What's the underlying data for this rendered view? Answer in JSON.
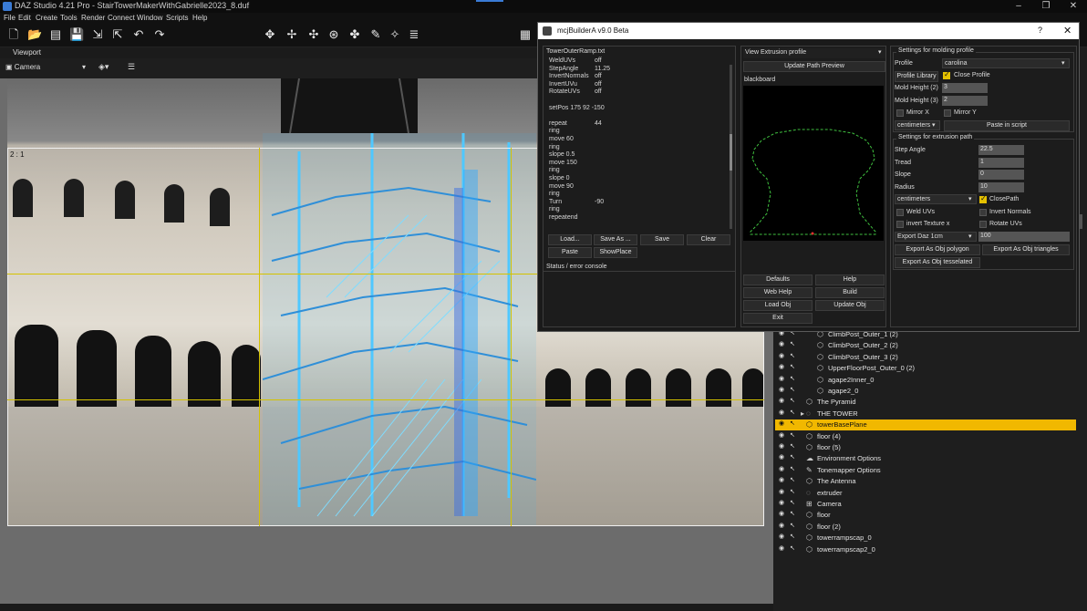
{
  "app": {
    "title": "DAZ Studio 4.21 Pro - StairTowerMakerWithGabrielle2023_8.duf",
    "icon": "daz-studio-icon",
    "window_controls": [
      "–",
      "❐",
      "✕"
    ]
  },
  "menu": [
    "File",
    "Edit",
    "Create",
    "Tools",
    "Render",
    "Connect",
    "Window",
    "Scripts",
    "Help"
  ],
  "viewport": {
    "tab_label": "Viewport",
    "camera": "Camera",
    "frame_label": "2 : 1"
  },
  "plugin": {
    "title": "mcjBuilderA v9.0 Beta",
    "help": "?",
    "close": "✕",
    "script": {
      "file_name": "TowerOuterRamp.txt",
      "lines": [
        {
          "k": "WeldUVs",
          "v": "off"
        },
        {
          "k": "StepAngle",
          "v": "11.25"
        },
        {
          "k": "InvertNormals",
          "v": "off"
        },
        {
          "k": "InvertUVu",
          "v": "off"
        },
        {
          "k": "RotateUVs",
          "v": "off"
        },
        {
          "k": "",
          "v": ""
        },
        {
          "k": "setPos 175 92 -150",
          "v": ""
        },
        {
          "k": "",
          "v": ""
        },
        {
          "k": "repeat",
          "v": "44"
        },
        {
          "k": "ring",
          "v": ""
        },
        {
          "k": "move 60",
          "v": ""
        },
        {
          "k": "ring",
          "v": ""
        },
        {
          "k": "slope 0.5",
          "v": ""
        },
        {
          "k": "move 150",
          "v": ""
        },
        {
          "k": "ring",
          "v": ""
        },
        {
          "k": "slope 0",
          "v": ""
        },
        {
          "k": "move 90",
          "v": ""
        },
        {
          "k": "ring",
          "v": ""
        },
        {
          "k": "Turn",
          "v": "-90"
        },
        {
          "k": "ring",
          "v": ""
        },
        {
          "k": "repeatend",
          "v": ""
        }
      ],
      "buttons": [
        "Load...",
        "Save As ...",
        "Save",
        "Clear",
        "Paste",
        "ShowPlace"
      ],
      "status_label": "Status / error console"
    },
    "profile": {
      "view_select": "View Extrusion profile",
      "update_button": "Update Path Preview",
      "blackboard_label": "blackboard",
      "buttons": [
        "Defaults",
        "Help",
        "Web Help",
        "Build",
        "Load Obj",
        "Update Obj",
        "Exit"
      ]
    },
    "molding": {
      "section_title": "Settings for molding profile",
      "profile_label": "Profile",
      "profile_value": "carolina",
      "profile_library": "Profile Library",
      "close_profile": "Close Profile",
      "close_profile_checked": true,
      "mold_height_2_label": "Mold Height (2)",
      "mold_height_2": "3",
      "mold_height_3_label": "Mold Height (3)",
      "mold_height_3": "2",
      "mirror_x": "Mirror X",
      "mirror_y": "Mirror Y",
      "units": "centimeters",
      "paste_button": "Paste in script"
    },
    "extrusion": {
      "section_title": "Settings for extrusion path",
      "step_angle_label": "Step Angle",
      "step_angle": "22.5",
      "tread_label": "Tread",
      "tread": "1",
      "slope_label": "Slope",
      "slope": "0",
      "radius_label": "Radius",
      "radius": "10",
      "units": "centimeters",
      "close_path": "ClosePath",
      "close_path_checked": true,
      "weld_uvs": "Weld UVs",
      "invert_normals": "Invert Normals",
      "invert_texture": "invert Texture x",
      "rotate_uvs": "Rotate UVs",
      "export_scale": "Export Daz 1cm",
      "export_scale_value": "100",
      "export_polygon": "Export As Obj polygon",
      "export_triangles": "Export As Obj triangles",
      "export_tesselated": "Export As Obj tesselated"
    }
  },
  "scene_tree": [
    {
      "label": "ClimbPost_Outer_1 (2)",
      "icon": "figure-icon",
      "indent": 2,
      "selected": false
    },
    {
      "label": "ClimbPost_Outer_2 (2)",
      "icon": "figure-icon",
      "indent": 2,
      "selected": false
    },
    {
      "label": "ClimbPost_Outer_3 (2)",
      "icon": "figure-icon",
      "indent": 2,
      "selected": false
    },
    {
      "label": "UpperFloorPost_Outer_0 (2)",
      "icon": "figure-icon",
      "indent": 2,
      "selected": false
    },
    {
      "label": "agape2Inner_0",
      "icon": "figure-icon",
      "indent": 2,
      "selected": false
    },
    {
      "label": "agape2_0",
      "icon": "figure-icon",
      "indent": 2,
      "selected": false
    },
    {
      "label": "The Pyramid",
      "icon": "figure-icon",
      "indent": 1,
      "selected": false
    },
    {
      "label": "THE TOWER",
      "icon": "group-icon",
      "indent": 1,
      "selected": false
    },
    {
      "label": "towerBasePlane",
      "icon": "figure-icon",
      "indent": 1,
      "selected": true
    },
    {
      "label": "floor (4)",
      "icon": "figure-icon",
      "indent": 1,
      "selected": false
    },
    {
      "label": "floor (5)",
      "icon": "figure-icon",
      "indent": 1,
      "selected": false
    },
    {
      "label": "Environment Options",
      "icon": "environment-icon",
      "indent": 1,
      "selected": false
    },
    {
      "label": "Tonemapper Options",
      "icon": "tonemapper-icon",
      "indent": 1,
      "selected": false
    },
    {
      "label": "The Antenna",
      "icon": "figure-icon",
      "indent": 1,
      "selected": false
    },
    {
      "label": "extruder",
      "icon": "group-icon",
      "indent": 1,
      "selected": false
    },
    {
      "label": "Camera",
      "icon": "camera-icon",
      "indent": 1,
      "selected": false
    },
    {
      "label": "floor",
      "icon": "figure-icon",
      "indent": 1,
      "selected": false
    },
    {
      "label": "floor (2)",
      "icon": "figure-icon",
      "indent": 1,
      "selected": false
    },
    {
      "label": "towerrampscap_0",
      "icon": "figure-icon",
      "indent": 1,
      "selected": false
    },
    {
      "label": "towerrampscap2_0",
      "icon": "figure-icon",
      "indent": 1,
      "selected": false
    }
  ],
  "colors": {
    "selection": "#f1b800",
    "staircase": "#3fb6f0",
    "guide": "#d4c200",
    "profile_curve": "#3fbf3f"
  }
}
